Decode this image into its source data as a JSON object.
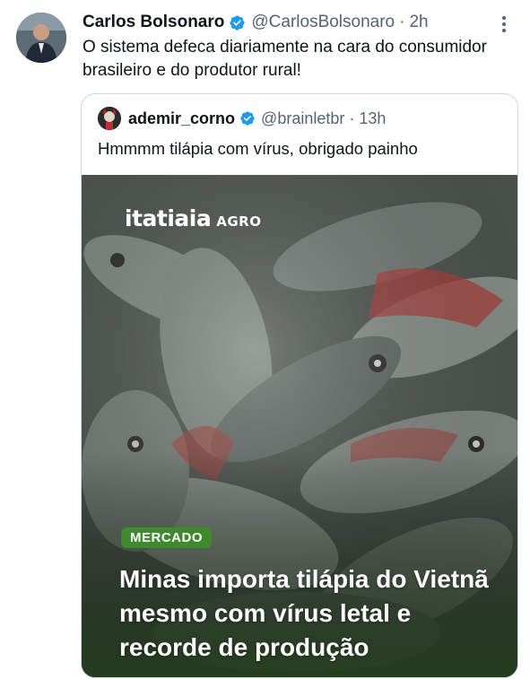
{
  "tweet": {
    "author_name": "Carlos Bolsonaro",
    "handle": "@CarlosBolsonaro",
    "separator": "·",
    "time": "2h",
    "text": "O sistema defeca diariamente na cara do consumidor brasileiro e do produtor rural!"
  },
  "quoted": {
    "author_name": "ademir_corno",
    "handle": "@brainletbr",
    "separator": "·",
    "time": "13h",
    "text": "Hmmmm tilápia com vírus, obrigado painho",
    "media": {
      "brand": "itatiaia",
      "brand_sub": "AGRO",
      "category": "MERCADO",
      "headline": "Minas importa tilápia do Vietnã mesmo com vírus letal e recorde de produção"
    }
  },
  "colors": {
    "verified": "#1d9bf0",
    "badge": "#3f8a2f",
    "muted": "#536471"
  },
  "icons": [
    "verified-badge-icon",
    "more-options-icon"
  ]
}
